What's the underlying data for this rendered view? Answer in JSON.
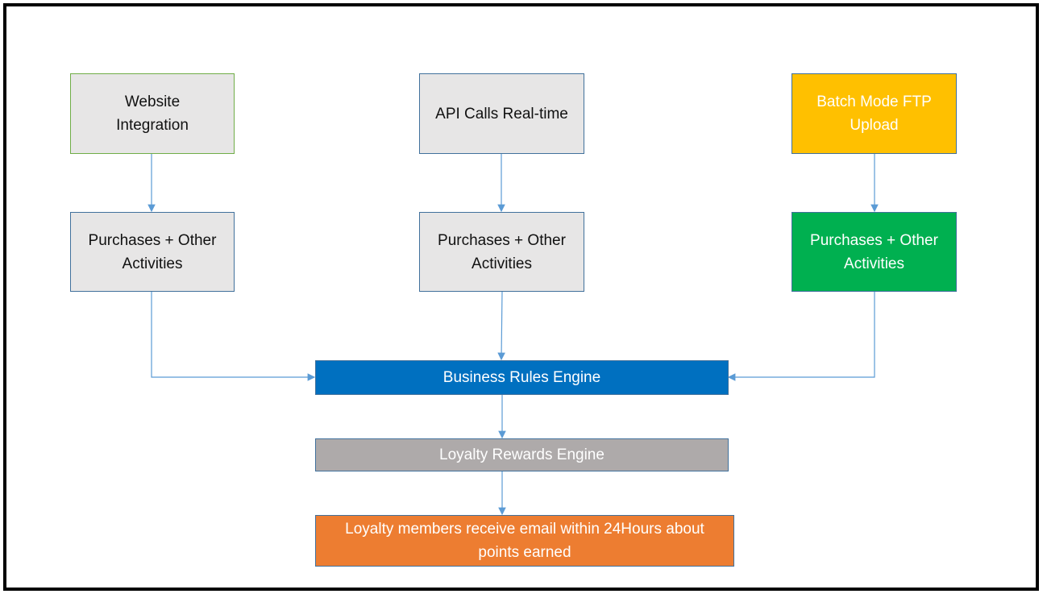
{
  "nodes": {
    "website_integration": "Website Integration",
    "api_calls": "API Calls Real-time",
    "batch_ftp": "Batch Mode FTP Upload",
    "purchases_1": "Purchases + Other Activities",
    "purchases_2": "Purchases + Other Activities",
    "purchases_3": "Purchases + Other Activities",
    "business_rules": "Business Rules Engine",
    "loyalty_rewards": "Loyalty Rewards Engine",
    "email_notice": "Loyalty members receive email within 24Hours about points earned"
  },
  "colors": {
    "batch_ftp": "#ffc000",
    "purchases_3": "#00b050",
    "business_rules": "#0070c0",
    "loyalty_rewards": "#aeaaaa",
    "email_notice": "#ed7d31",
    "connector": "#5b9bd5"
  }
}
